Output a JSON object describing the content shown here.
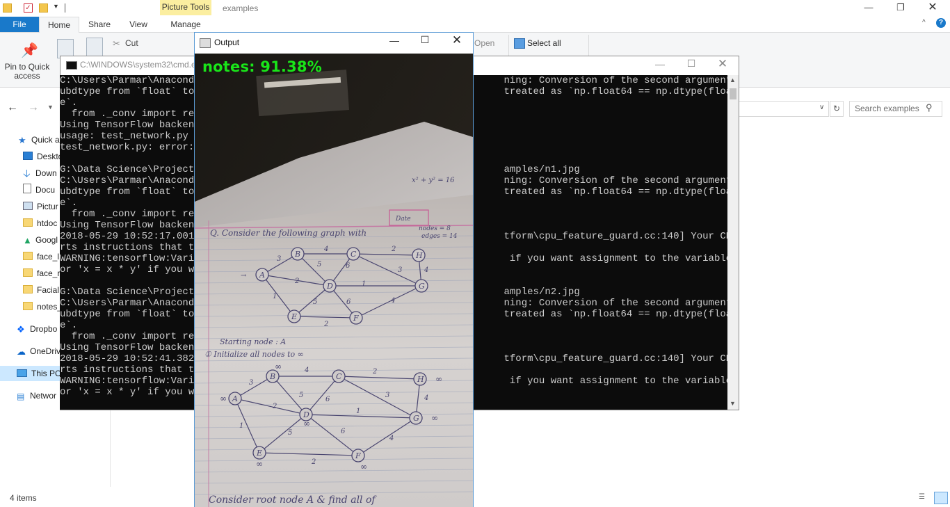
{
  "explorer": {
    "context_tab": "Picture Tools",
    "window_title": "examples",
    "tabs": {
      "file": "File",
      "home": "Home",
      "share": "Share",
      "view": "View",
      "manage": "Manage"
    },
    "ribbon": {
      "pin_line1": "Pin to Quick",
      "pin_line2": "access",
      "cut": "Cut",
      "open": "Open",
      "select_all": "Select all"
    },
    "search_placeholder": "Search examples",
    "nav": [
      "Quick a",
      "Deskto",
      "Down",
      "Docu",
      "Pictur",
      "htdoc",
      "Googl",
      "face_l",
      "face_r",
      "Facial",
      "notes_",
      "Dropbo",
      "OneDriv",
      "This PC",
      "Networ"
    ],
    "status": "4 items"
  },
  "cmd": {
    "title": "C:\\WINDOWS\\system32\\cmd.e",
    "lines": [
      "C:\\Users\\Parmar\\Anaconda                                                    ning: Conversion of the second argument of iss",
      "ubdtype from `float` to                                                     treated as `np.float64 == np.dtype(float).typ",
      "e`.",
      "  from ._conv import reg",
      "Using TensorFlow backend",
      "usage: test_network.py [",
      "test_network.py: error:",
      "",
      "G:\\Data Science\\Projects                                                    amples/n1.jpg",
      "C:\\Users\\Parmar\\Anaconda                                                    ning: Conversion of the second argument of iss",
      "ubdtype from `float` to                                                     treated as `np.float64 == np.dtype(float).typ",
      "e`.",
      "  from ._conv import reg",
      "Using TensorFlow backend",
      "2018-05-29 10:52:17.0016                                                    tform\\cpu_feature_guard.cc:140] Your CPU suppo",
      "rts instructions that th",
      "WARNING:tensorflow:Varia                                                     if you want assignment to the variable value",
      "or 'x = x * y' if you wa",
      "",
      "G:\\Data Science\\Projects                                                    amples/n2.jpg",
      "C:\\Users\\Parmar\\Anaconda                                                    ning: Conversion of the second argument of iss",
      "ubdtype from `float` to                                                     treated as `np.float64 == np.dtype(float).typ",
      "e`.",
      "  from ._conv import reg",
      "Using TensorFlow backend",
      "2018-05-29 10:52:41.3821                                                    tform\\cpu_feature_guard.cc:140] Your CPU suppo",
      "rts instructions that th",
      "WARNING:tensorflow:Varia                                                     if you want assignment to the variable value",
      "or 'x = x * y' if you wa"
    ]
  },
  "output": {
    "title": "Output",
    "label": "notes: 91.38%"
  },
  "photo": {
    "date_label": "Date",
    "question": "Q.  Consider the following graph with",
    "nodes_eq": "nodes = 8",
    "edges_eq": "edges = 14",
    "step_start": "Starting node : A",
    "step_init": "①  Initialize all nodes to ∞",
    "bottom_text": "Consider root node A & find all of",
    "formula": "x² + y² = 16",
    "inf": "∞",
    "nodes": [
      "A",
      "B",
      "C",
      "D",
      "E",
      "F",
      "G",
      "H"
    ],
    "weights": [
      "3",
      "4",
      "2",
      "2",
      "5",
      "6",
      "1",
      "3",
      "4",
      "1",
      "5",
      "6",
      "2",
      "4"
    ]
  }
}
